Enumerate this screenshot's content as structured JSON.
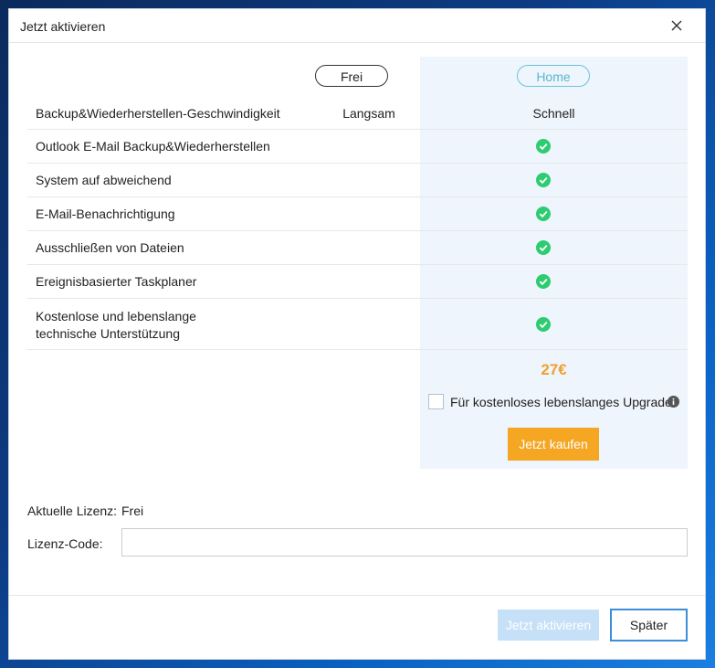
{
  "dialog": {
    "title": "Jetzt aktivieren"
  },
  "plans": {
    "free_label": "Frei",
    "home_label": "Home"
  },
  "features": [
    {
      "label": "Backup&Wiederherstellen-Geschwindigkeit",
      "free": "Langsam",
      "home": "Schnell"
    },
    {
      "label": "Outlook E-Mail Backup&Wiederherstellen",
      "free": "",
      "home": "check"
    },
    {
      "label": "System auf abweichend",
      "free": "",
      "home": "check"
    },
    {
      "label": "E-Mail-Benachrichtigung",
      "free": "",
      "home": "check"
    },
    {
      "label": "Ausschließen von Dateien",
      "free": "",
      "home": "check"
    },
    {
      "label": "Ereignisbasierter Taskplaner",
      "free": "",
      "home": "check"
    },
    {
      "label_line1": "Kostenlose und lebenslange",
      "label_line2": "technische Unterstützung",
      "free": "",
      "home": "check"
    }
  ],
  "purchase": {
    "price": "27€",
    "upgrade_label": "Für kostenloses lebenslanges Upgrade",
    "upgrade_checked": false,
    "buy_label": "Jetzt kaufen"
  },
  "license": {
    "current_label": "Aktuelle Lizenz:",
    "current_value": "Frei",
    "code_label": "Lizenz-Code:",
    "code_value": ""
  },
  "footer": {
    "activate_label": "Jetzt aktivieren",
    "later_label": "Später"
  },
  "icons": {
    "close": "close-icon",
    "check": "check-circle-icon",
    "info": "info-icon"
  },
  "colors": {
    "accent": "#f5a623",
    "check": "#2ecc71",
    "home_column": "#eef5fc",
    "activate_disabled": "#c6e1f7",
    "later_border": "#3a8fd8"
  }
}
